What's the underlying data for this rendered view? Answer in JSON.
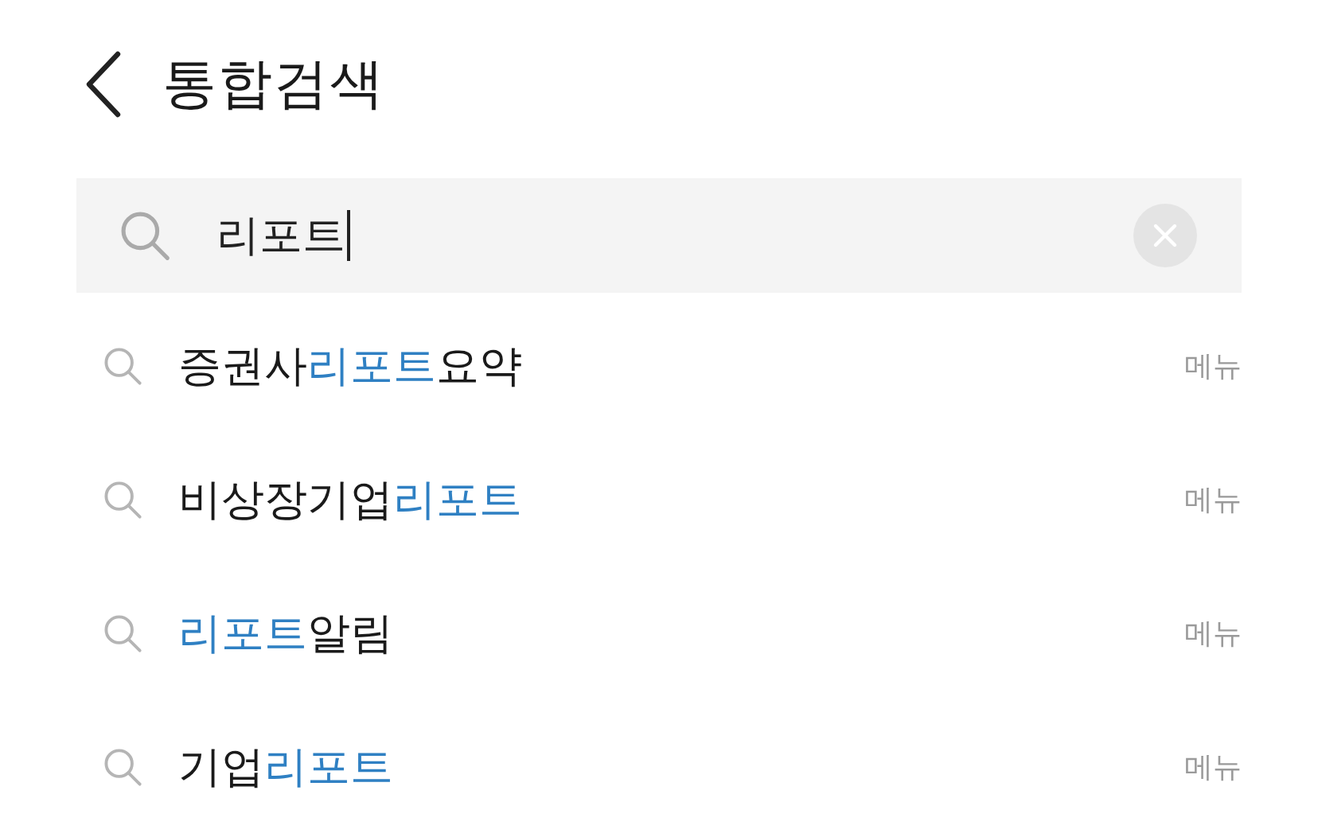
{
  "header": {
    "title": "통합검색"
  },
  "search": {
    "value": "리포트"
  },
  "suggestions": [
    {
      "parts": [
        {
          "text": "증권사",
          "match": false
        },
        {
          "text": "리포트",
          "match": true
        },
        {
          "text": "요약",
          "match": false
        }
      ],
      "category": "메뉴"
    },
    {
      "parts": [
        {
          "text": "비상장기업",
          "match": false
        },
        {
          "text": "리포트",
          "match": true
        }
      ],
      "category": "메뉴"
    },
    {
      "parts": [
        {
          "text": "리포트",
          "match": true
        },
        {
          "text": "알림",
          "match": false
        }
      ],
      "category": "메뉴"
    },
    {
      "parts": [
        {
          "text": "기업",
          "match": false
        },
        {
          "text": "리포트",
          "match": true
        }
      ],
      "category": "메뉴"
    }
  ]
}
